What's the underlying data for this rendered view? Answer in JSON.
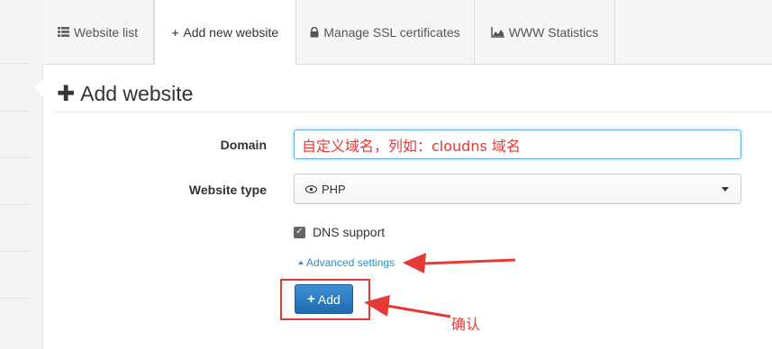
{
  "tabs": [
    {
      "label": "Website list",
      "icon": "list-icon",
      "active": false
    },
    {
      "label": "Add new website",
      "icon": "plus-icon",
      "active": true
    },
    {
      "label": "Manage SSL certificates",
      "icon": "lock-icon",
      "active": false
    },
    {
      "label": "WWW Statistics",
      "icon": "area-chart-icon",
      "active": false
    }
  ],
  "page": {
    "title": "Add website"
  },
  "form": {
    "domain_label": "Domain",
    "domain_value": "自定义域名，列如：cloudns 域名",
    "type_label": "Website type",
    "type_value": "PHP",
    "dns_label": "DNS support",
    "dns_checked": true,
    "advanced_label": "Advanced settings",
    "add_label": "Add"
  },
  "annotation": {
    "confirm_text": "确认",
    "color": "#e53935"
  },
  "colors": {
    "primary": "#2a7dc4",
    "link": "#2a8fc1",
    "annotation_red": "#e53935"
  }
}
